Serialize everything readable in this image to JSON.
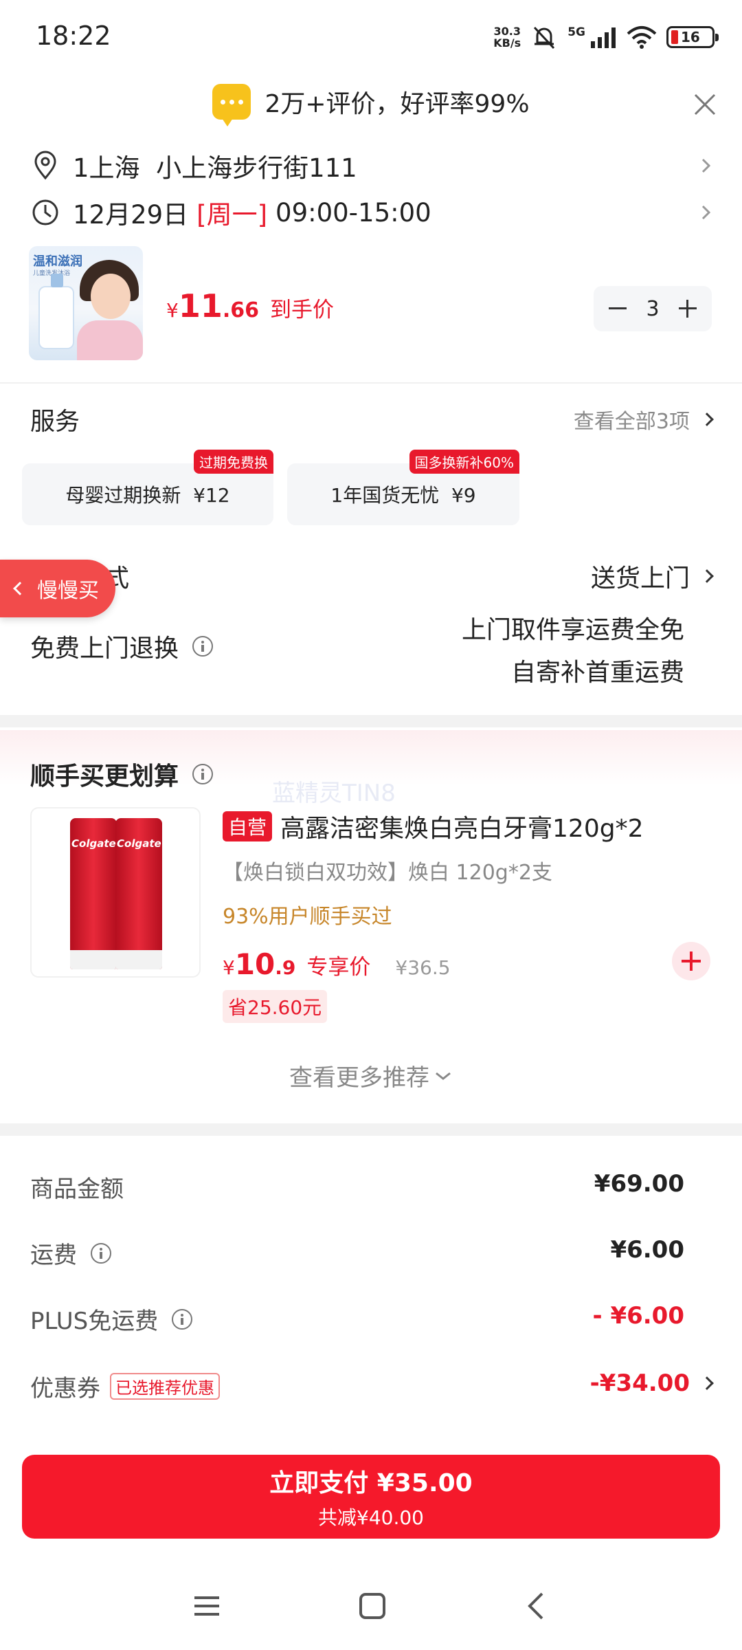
{
  "status": {
    "time": "18:22",
    "net_speed_value": "30.3",
    "net_speed_unit": "KB/s",
    "network": "5G",
    "battery": "16"
  },
  "review": {
    "text": "2万+评价，好评率99%"
  },
  "address": {
    "text": "1上海  小上海步行街111",
    "date": "12月29日",
    "weekday": "[周一]",
    "time_window": "09:00-15:00"
  },
  "product": {
    "image_title": "温和滋润",
    "image_subtitle": "儿童洗发沐浴",
    "price_symbol": "¥",
    "price_int": "11",
    "price_dec": ".66",
    "price_tag": "到手价",
    "quantity": "3"
  },
  "services": {
    "title": "服务",
    "view_all": "查看全部3项",
    "items": [
      {
        "label": "母婴过期换新  ¥12",
        "badge": "过期免费换"
      },
      {
        "label": "1年国货无忧  ¥9",
        "badge": "国多换新补60%"
      }
    ]
  },
  "shipping": {
    "label": "收货方式",
    "value": "送货上门",
    "slow_buy": "慢慢买",
    "return_label": "免费上门退换",
    "return_line1": "上门取件享运费全免",
    "return_line2": "自寄补首重运费"
  },
  "recommend": {
    "title": "顺手买更划算",
    "watermark": "蓝精灵TIN8",
    "tag": "自营",
    "brand_on_tube": "Colgate",
    "name": "高露洁密集焕白亮白牙膏120g*2",
    "desc": "【焕白锁白双功效】焕白 120g*2支",
    "stat": "93%用户顺手买过",
    "price_symbol": "¥",
    "price_int": "10",
    "price_dec": ".9",
    "price_tag": "专享价",
    "old_price": "¥36.5",
    "save": "省25.60元",
    "see_more": "查看更多推荐"
  },
  "summary": {
    "rows": [
      {
        "label": "商品金额",
        "value": "¥69.00"
      },
      {
        "label": "运费",
        "value": "¥6.00"
      },
      {
        "label": "PLUS免运费",
        "value": "- ¥6.00"
      },
      {
        "label": "优惠券",
        "tag": "已选推荐优惠",
        "value": "-¥34.00"
      }
    ]
  },
  "pay": {
    "main": "立即支付 ¥35.00",
    "sub": "共减¥40.00"
  },
  "colors": {
    "accent": "#e8192c",
    "pay_button": "#f5192b",
    "stat_text": "#c7862a"
  }
}
